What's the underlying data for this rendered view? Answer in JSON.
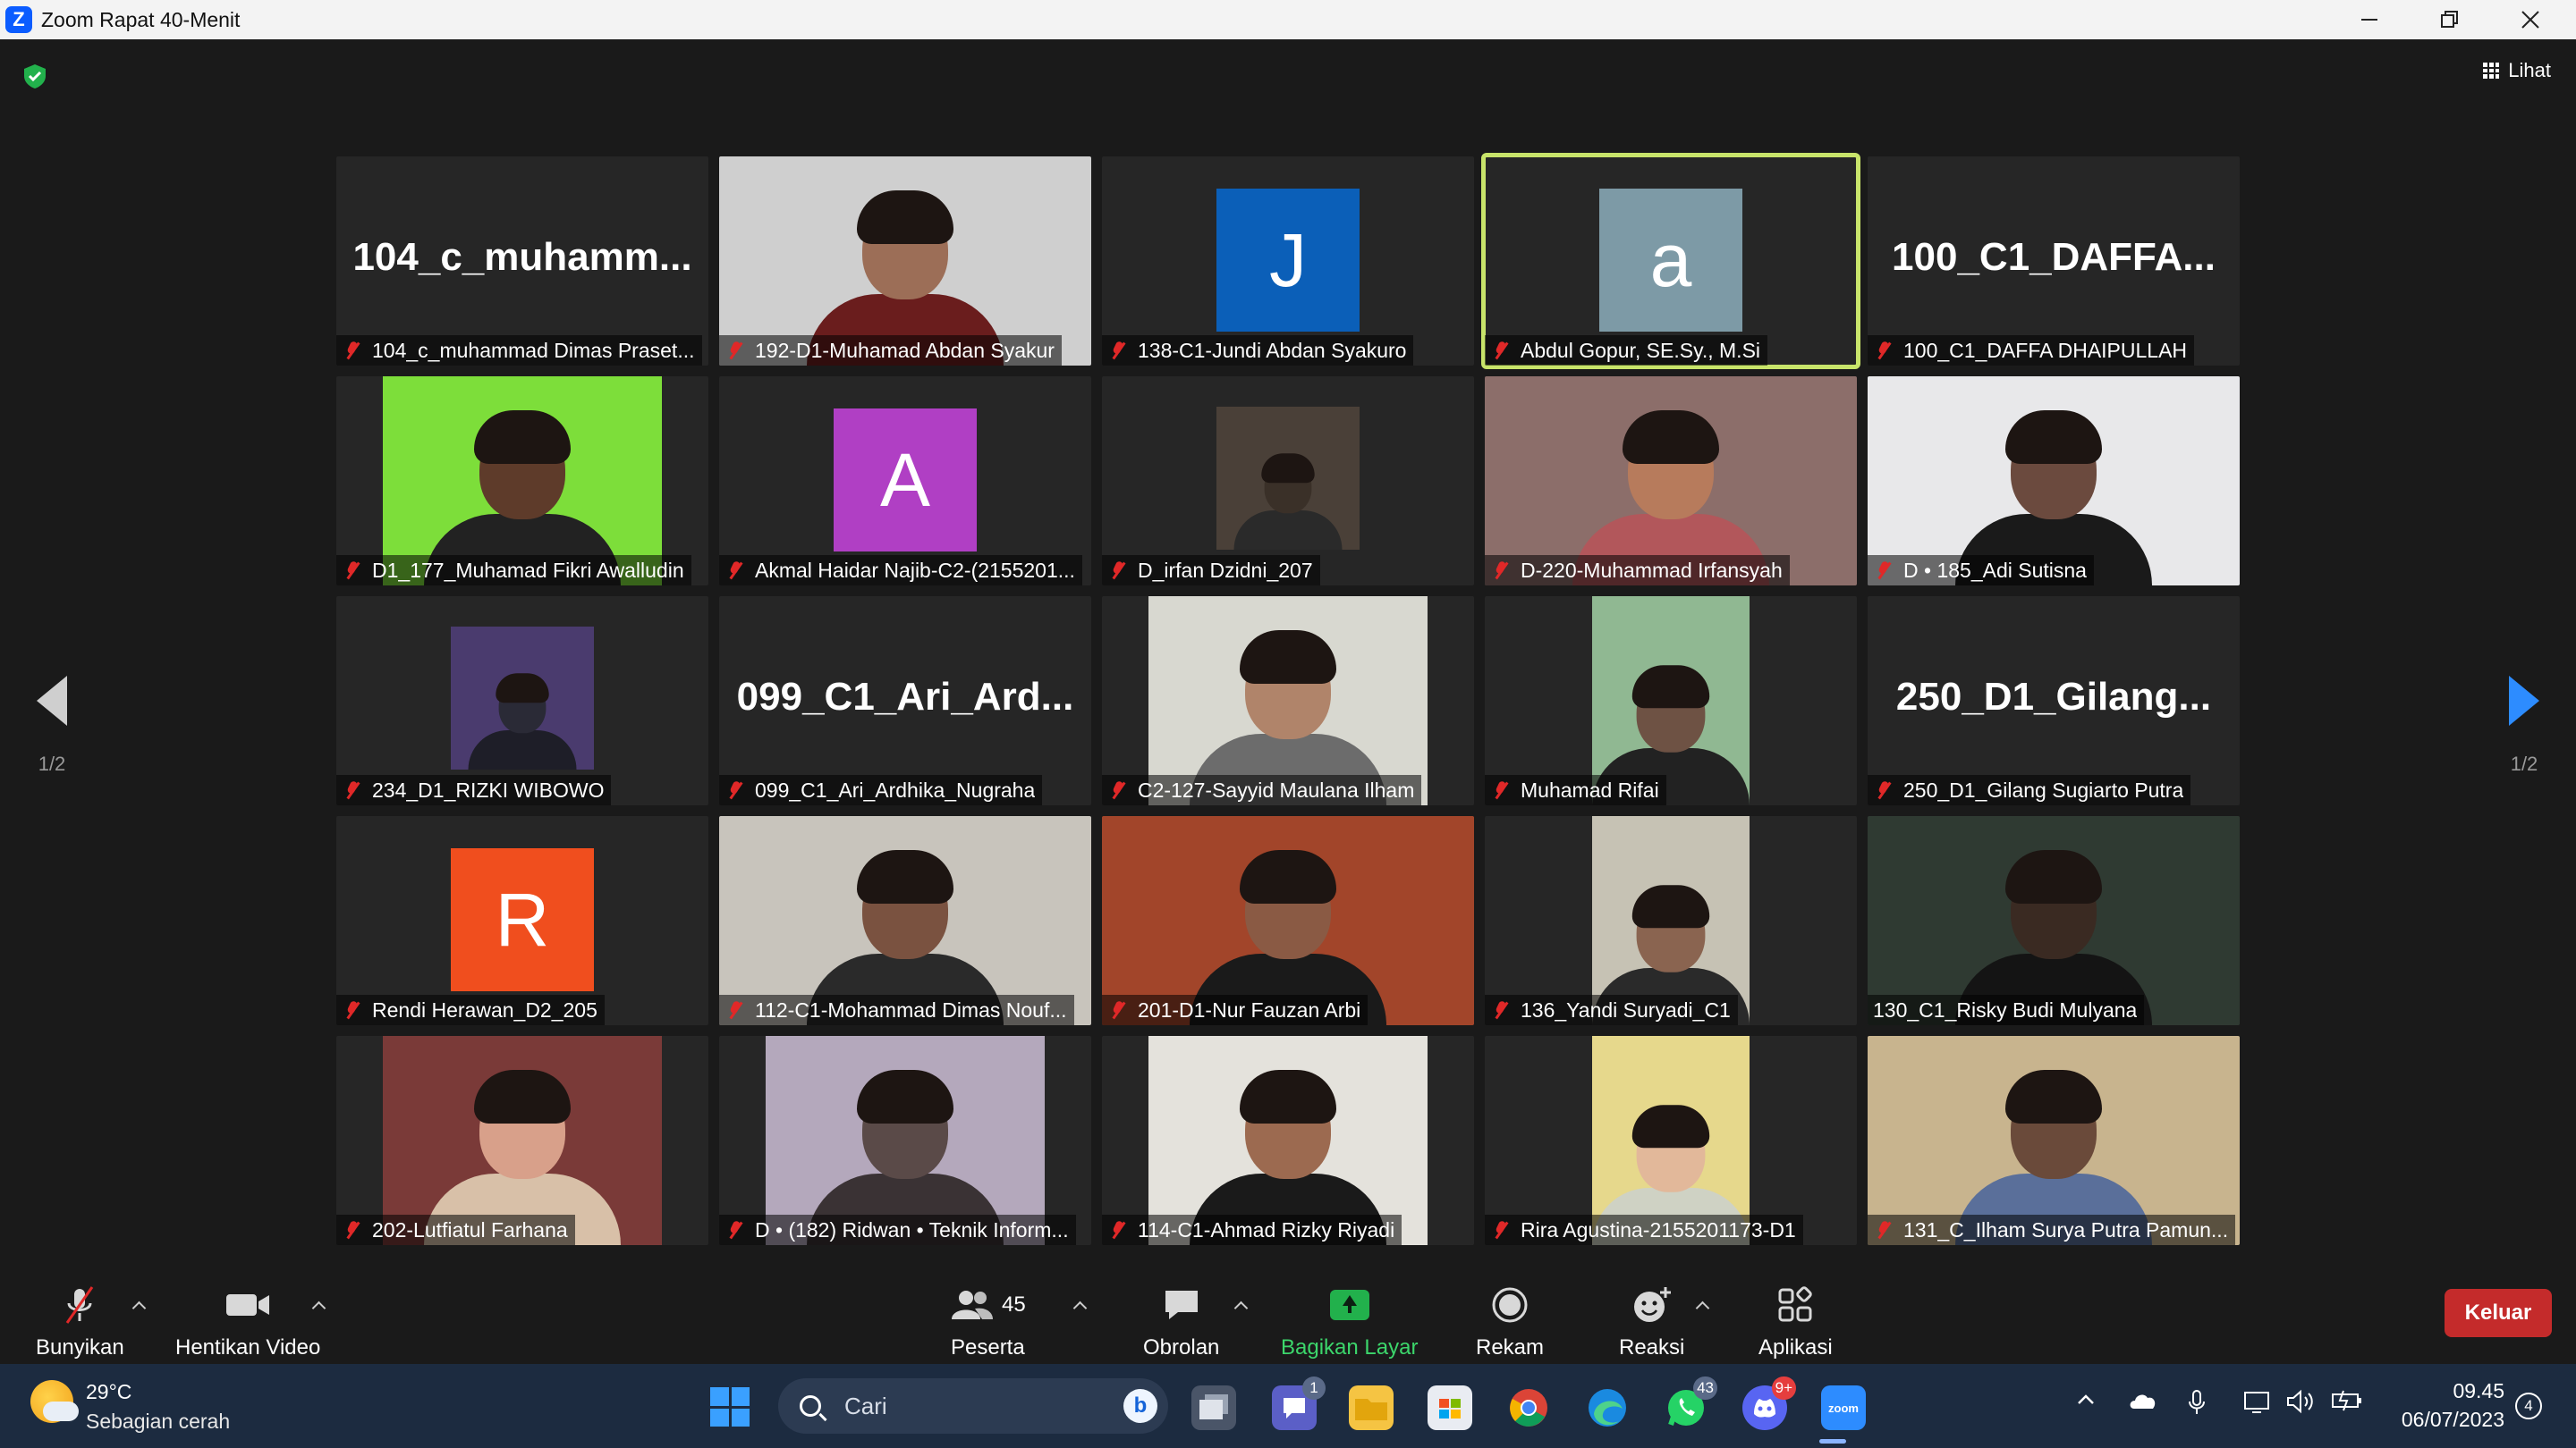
{
  "window": {
    "title": "Zoom Rapat 40-Menit",
    "app_icon": "zoom-z-icon",
    "controls": [
      "minimize",
      "restore",
      "close"
    ]
  },
  "meeting": {
    "security_icon": "shield-check-icon",
    "view_label": "Lihat",
    "page_indicator": "1/2",
    "tiles": [
      {
        "name": "104_c_muhammad Dimas Praset...",
        "big_name": "104_c_muhamm...",
        "kind": "name"
      },
      {
        "name": "192-D1-Muhamad Abdan Syakur",
        "kind": "video",
        "bg": "#cfcfcf",
        "skin": "#9c6e57",
        "shirt": "#6a1d1d"
      },
      {
        "name": "138-C1-Jundi Abdan Syakuro",
        "avatar": "J",
        "avatar_color": "#0b5fb8",
        "kind": "avatar"
      },
      {
        "name": "Abdul Gopur, SE.Sy., M.Si",
        "avatar": "a",
        "avatar_color": "#7d9aa6",
        "kind": "avatar",
        "active": true
      },
      {
        "name": "100_C1_DAFFA DHAIPULLAH",
        "big_name": "100_C1_DAFFA...",
        "kind": "name"
      },
      {
        "name": "D1_177_Muhamad Fikri Awalludin",
        "kind": "video-narrow",
        "bg": "#7dde3a",
        "skin": "#5e3b2a",
        "shirt": "#222"
      },
      {
        "name": "Akmal Haidar Najib-C2-(2155201...",
        "avatar": "A",
        "avatar_color": "#b03fc4",
        "kind": "avatar"
      },
      {
        "name": "D_irfan Dzidni_207",
        "kind": "video-xs",
        "bg": "#4a4038",
        "skin": "#3a3028",
        "shirt": "#2a2a2a"
      },
      {
        "name": "D-220-Muhammad Irfansyah",
        "kind": "video",
        "bg": "#8c6e6a",
        "skin": "#b77b5c",
        "shirt": "#b2575b"
      },
      {
        "name": "D • 185_Adi Sutisna",
        "kind": "video",
        "bg": "#e8e8ea",
        "skin": "#6b4a3e",
        "shirt": "#1a1a1a"
      },
      {
        "name": "234_D1_RIZKI WIBOWO",
        "kind": "video-xs",
        "bg": "#4a3b6e",
        "skin": "#2a2a36",
        "shirt": "#1e1e28"
      },
      {
        "name": "099_C1_Ari_Ardhika_Nugraha",
        "big_name": "099_C1_Ari_Ard...",
        "kind": "name"
      },
      {
        "name": "C2-127-Sayyid Maulana Ilham",
        "kind": "video-narrow",
        "bg": "#d8d8d0",
        "skin": "#b0846a",
        "shirt": "#6c6c6c"
      },
      {
        "name": "Muhamad Rifai",
        "kind": "video-slim",
        "bg": "#90b892",
        "skin": "#6e5244",
        "shirt": "#222"
      },
      {
        "name": "250_D1_Gilang Sugiarto Putra",
        "big_name": "250_D1_Gilang...",
        "kind": "name"
      },
      {
        "name": "Rendi Herawan_D2_205",
        "avatar": "R",
        "avatar_color": "#f04e1e",
        "kind": "avatar"
      },
      {
        "name": "112-C1-Mohammad Dimas Nouf...",
        "kind": "video",
        "bg": "#c8c4bc",
        "skin": "#7a5240",
        "shirt": "#2a2a2a"
      },
      {
        "name": "201-D1-Nur Fauzan Arbi",
        "kind": "video",
        "bg": "#a2452a",
        "skin": "#8a5a44",
        "shirt": "#1a1a1a"
      },
      {
        "name": "136_Yandi Suryadi_C1",
        "kind": "video-slim",
        "bg": "#c6c2b4",
        "skin": "#8a6450",
        "shirt": "#2a2a2a"
      },
      {
        "name": "130_C1_Risky Budi Mulyana",
        "kind": "video",
        "bg": "#2f3a32",
        "skin": "#3a2a22",
        "shirt": "#141414",
        "nomute": true
      },
      {
        "name": "202-Lutfiatul Farhana",
        "kind": "video-narrow",
        "bg": "#7a3a38",
        "skin": "#d8a08a",
        "shirt": "#d8c0a8"
      },
      {
        "name": "D • (182) Ridwan • Teknik Inform...",
        "kind": "video-narrow",
        "bg": "#b4a8bc",
        "skin": "#5a4a48",
        "shirt": "#3a3234"
      },
      {
        "name": "114-C1-Ahmad Rizky Riyadi",
        "kind": "video-narrow",
        "bg": "#e4e2dc",
        "skin": "#9c6a50",
        "shirt": "#1a1a1a"
      },
      {
        "name": "Rira Agustina-2155201173-D1",
        "kind": "video-slim",
        "bg": "#e6d88c",
        "skin": "#e2b89a",
        "shirt": "#cfd2c4"
      },
      {
        "name": "131_C_Ilham Surya Putra Pamun...",
        "kind": "video",
        "bg": "#c8b48e",
        "skin": "#6a4a3a",
        "shirt": "#5a6f9a"
      }
    ]
  },
  "toolbar": {
    "mute_label": "Bunyikan",
    "video_label": "Hentikan Video",
    "participants_label": "Peserta",
    "participants_count": "45",
    "chat_label": "Obrolan",
    "share_label": "Bagikan Layar",
    "record_label": "Rekam",
    "reactions_label": "Reaksi",
    "apps_label": "Aplikasi",
    "leave_label": "Keluar",
    "share_color": "#3cd66b",
    "leave_color": "#c42b2b"
  },
  "taskbar": {
    "weather_temp": "29°C",
    "weather_desc": "Sebagian cerah",
    "search_placeholder": "Cari",
    "teams_badge": "1",
    "whatsapp_badge": "43",
    "discord_badge": "9+",
    "zoom_app_label": "zoom",
    "time": "09.45",
    "date": "06/07/2023",
    "notification_count": "4"
  }
}
